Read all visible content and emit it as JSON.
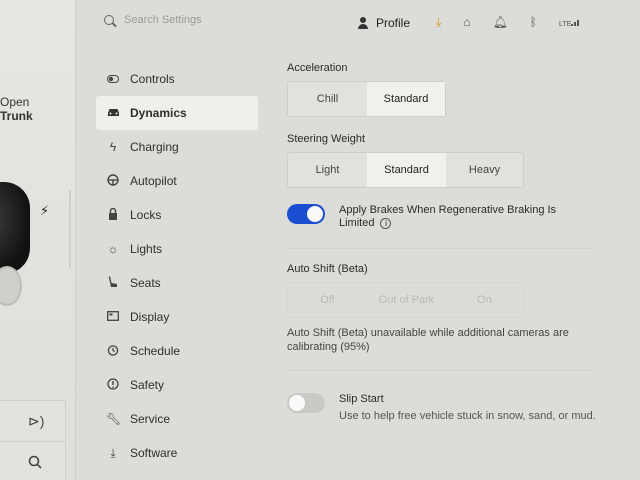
{
  "car": {
    "open_label": "Open",
    "trunk_label": "Trunk"
  },
  "search": {
    "placeholder": "Search Settings"
  },
  "header": {
    "profile_label": "Profile",
    "status_icons": [
      "download-icon",
      "garage-icon",
      "bell-icon",
      "bluetooth-icon",
      "lte-signal-icon"
    ],
    "lte_label": "LTE",
    "accent_color": "#d9920f"
  },
  "nav": {
    "items": [
      {
        "label": "Controls",
        "icon": "toggle-icon"
      },
      {
        "label": "Dynamics",
        "icon": "car-icon",
        "active": true
      },
      {
        "label": "Charging",
        "icon": "bolt-icon"
      },
      {
        "label": "Autopilot",
        "icon": "steering-wheel-icon"
      },
      {
        "label": "Locks",
        "icon": "lock-icon"
      },
      {
        "label": "Lights",
        "icon": "sun-icon"
      },
      {
        "label": "Seats",
        "icon": "seat-icon"
      },
      {
        "label": "Display",
        "icon": "display-icon"
      },
      {
        "label": "Schedule",
        "icon": "alarm-clock-icon"
      },
      {
        "label": "Safety",
        "icon": "info-circle-icon"
      },
      {
        "label": "Service",
        "icon": "wrench-icon"
      },
      {
        "label": "Software",
        "icon": "download-icon"
      }
    ]
  },
  "acceleration": {
    "label": "Acceleration",
    "options": [
      "Chill",
      "Standard"
    ],
    "selected": "Standard"
  },
  "steering": {
    "label": "Steering Weight",
    "options": [
      "Light",
      "Standard",
      "Heavy"
    ],
    "selected": "Standard"
  },
  "regen": {
    "label": "Apply Brakes When Regenerative Braking Is Limited",
    "enabled": true,
    "toggle_color": "#1a4fd1"
  },
  "autoshift": {
    "label": "Auto Shift (Beta)",
    "options": [
      "Off",
      "Out of Park",
      "On"
    ],
    "note": "Auto Shift (Beta) unavailable while additional cameras are calibrating (95%)"
  },
  "slip": {
    "label": "Slip Start",
    "description": "Use to help free vehicle stuck in snow, sand, or mud.",
    "enabled": false
  }
}
